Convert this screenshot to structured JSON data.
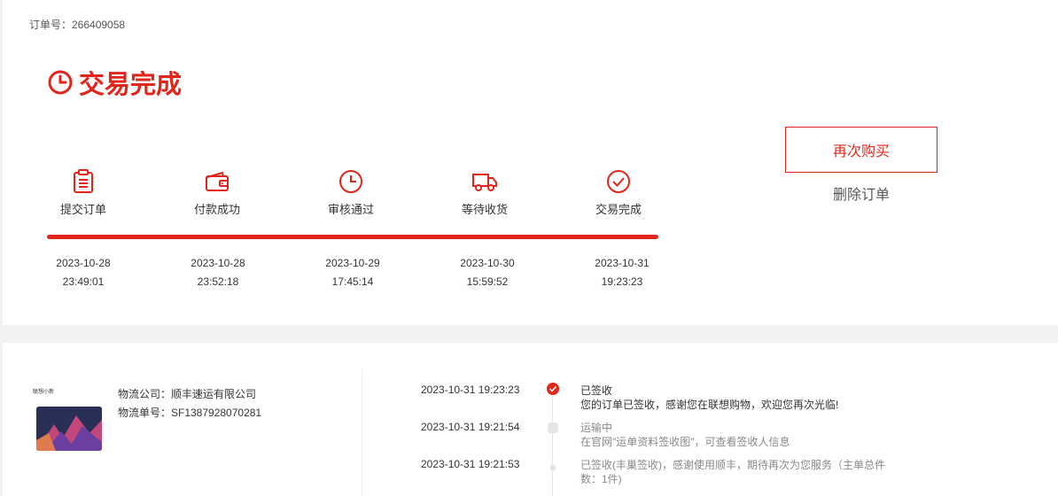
{
  "order": {
    "number_label": "订单号：266409058"
  },
  "status": {
    "title": "交易完成"
  },
  "steps": [
    {
      "label": "提交订单",
      "icon": "clipboard-icon",
      "date": "2023-10-28",
      "time": "23:49:01"
    },
    {
      "label": "付款成功",
      "icon": "wallet-icon",
      "date": "2023-10-28",
      "time": "23:52:18"
    },
    {
      "label": "审核通过",
      "icon": "clock-icon",
      "date": "2023-10-29",
      "time": "17:45:14"
    },
    {
      "label": "等待收货",
      "icon": "truck-icon",
      "date": "2023-10-30",
      "time": "15:59:52"
    },
    {
      "label": "交易完成",
      "icon": "check-circle-icon",
      "date": "2023-10-31",
      "time": "19:23:23"
    }
  ],
  "progress": {
    "fraction": 1.0
  },
  "actions": {
    "rebuy": "再次购买",
    "delete": "删除订单"
  },
  "logistics": {
    "product_brand": "联想小新",
    "company": "物流公司：顺丰速运有限公司",
    "tracking": "物流单号：SF1387928070281",
    "events": [
      {
        "time": "2023-10-31 19:23:23",
        "title": "已签收",
        "desc": "您的订单已签收，感谢您在联想购物，欢迎您再次光临!"
      },
      {
        "time": "2023-10-31 19:21:54",
        "title": "运输中",
        "desc": "在官网\"运单资料签收图\"，可查看签收人信息"
      },
      {
        "time": "2023-10-31 19:21:53",
        "title": "已签收(丰巢签收)，感谢使用顺丰，期待再次为您服务（主单总件数：1件)",
        "desc": ""
      }
    ]
  },
  "colors": {
    "accent": "#e1251b"
  }
}
